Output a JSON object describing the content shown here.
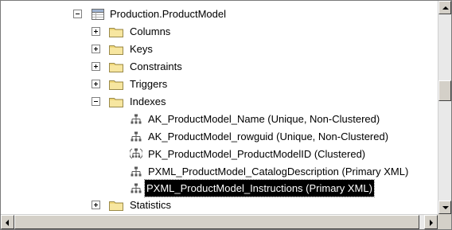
{
  "tree": {
    "table_node": {
      "label": "Production.ProductModel",
      "expanded": true
    },
    "children": [
      {
        "label": "Columns",
        "expanded": false
      },
      {
        "label": "Keys",
        "expanded": false
      },
      {
        "label": "Constraints",
        "expanded": false
      },
      {
        "label": "Triggers",
        "expanded": false
      },
      {
        "label": "Indexes",
        "expanded": true
      },
      {
        "label": "Statistics",
        "expanded": false
      }
    ],
    "indexes": [
      {
        "label": "AK_ProductModel_Name (Unique, Non-Clustered)",
        "icon": "index-icon"
      },
      {
        "label": "AK_ProductModel_rowguid (Unique, Non-Clustered)",
        "icon": "index-icon"
      },
      {
        "label": "PK_ProductModel_ProductModelID (Clustered)",
        "icon": "clustered-index-icon"
      },
      {
        "label": "PXML_ProductModel_CatalogDescription (Primary XML)",
        "icon": "index-icon"
      },
      {
        "label": "PXML_ProductModel_Instructions (Primary XML)",
        "icon": "index-icon",
        "selected": true
      }
    ]
  },
  "icons": {
    "table": "table-icon",
    "folder": "folder-icon",
    "index": "index-icon",
    "clustered_index": "clustered-index-icon"
  },
  "colors": {
    "selection_bg": "#000000",
    "selection_fg": "#ffffff",
    "folder": "#f0d77a",
    "scrollbar": "#d4d0c8"
  }
}
